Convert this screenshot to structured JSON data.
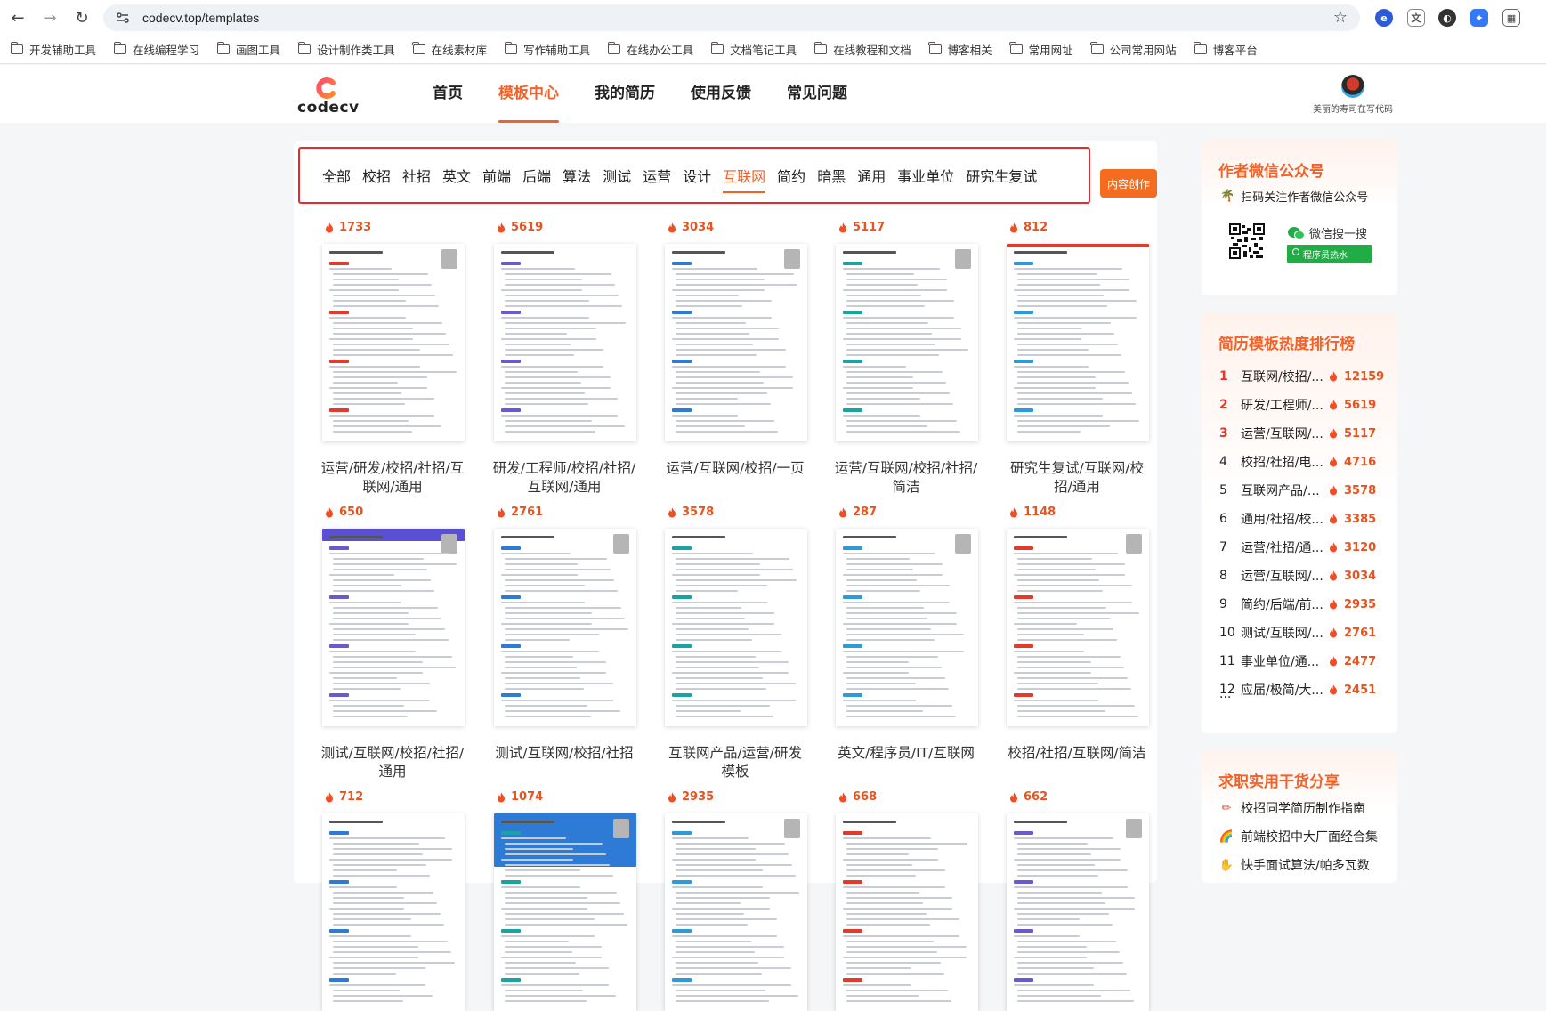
{
  "browser": {
    "url": "codecv.top/templates",
    "bookmarks": [
      "开发辅助工具",
      "在线编程学习",
      "画图工具",
      "设计制作类工具",
      "在线素材库",
      "写作辅助工具",
      "在线办公工具",
      "文档笔记工具",
      "在线教程和文档",
      "博客相关",
      "常用网址",
      "公司常用网站",
      "博客平台"
    ]
  },
  "header": {
    "logo_text": "codecv",
    "nav": [
      "首页",
      "模板中心",
      "我的简历",
      "使用反馈",
      "常见问题"
    ],
    "active_nav": "模板中心",
    "username": "美丽的寿司在写代码"
  },
  "filters": {
    "tags": [
      "全部",
      "校招",
      "社招",
      "英文",
      "前端",
      "后端",
      "算法",
      "测试",
      "运营",
      "设计",
      "互联网",
      "简约",
      "暗黑",
      "通用",
      "事业单位",
      "研究生复试"
    ],
    "active": "互联网",
    "create_button": "内容创作"
  },
  "templates": [
    {
      "hot": "1733",
      "title": "运营/研发/校招/社招/互联网/通用"
    },
    {
      "hot": "5619",
      "title": "研发/工程师/校招/社招/互联网/通用"
    },
    {
      "hot": "3034",
      "title": "运营/互联网/校招/一页"
    },
    {
      "hot": "5117",
      "title": "运营/互联网/校招/社招/简洁"
    },
    {
      "hot": "812",
      "title": "研究生复试/互联网/校招/通用"
    },
    {
      "hot": "650",
      "title": "测试/互联网/校招/社招/通用"
    },
    {
      "hot": "2761",
      "title": "测试/互联网/校招/社招"
    },
    {
      "hot": "3578",
      "title": "互联网产品/运营/研发模板"
    },
    {
      "hot": "287",
      "title": "英文/程序员/IT/互联网"
    },
    {
      "hot": "1148",
      "title": "校招/社招/互联网/简洁"
    },
    {
      "hot": "712",
      "title": ""
    },
    {
      "hot": "1074",
      "title": ""
    },
    {
      "hot": "2935",
      "title": ""
    },
    {
      "hot": "668",
      "title": ""
    },
    {
      "hot": "662",
      "title": ""
    }
  ],
  "sidebar": {
    "wechat": {
      "title": "作者微信公众号",
      "desc": "扫码关注作者微信公众号",
      "search_label": "微信搜一搜",
      "button": "程序员热水"
    },
    "ranking": {
      "title": "简历模板热度排行榜",
      "items": [
        {
          "rank": "1",
          "name": "互联网/校招/...",
          "count": "12159"
        },
        {
          "rank": "2",
          "name": "研发/工程师/...",
          "count": "5619"
        },
        {
          "rank": "3",
          "name": "运营/互联网/...",
          "count": "5117"
        },
        {
          "rank": "4",
          "name": "校招/社招/电...",
          "count": "4716"
        },
        {
          "rank": "5",
          "name": "互联网产品/运...",
          "count": "3578"
        },
        {
          "rank": "6",
          "name": "通用/社招/校...",
          "count": "3385"
        },
        {
          "rank": "7",
          "name": "运营/社招/通...",
          "count": "3120"
        },
        {
          "rank": "8",
          "name": "运营/互联网/...",
          "count": "3034"
        },
        {
          "rank": "9",
          "name": "简约/后端/前...",
          "count": "2935"
        },
        {
          "rank": "10",
          "name": "测试/互联网/...",
          "count": "2761"
        },
        {
          "rank": "11",
          "name": "事业单位/通...",
          "count": "2477"
        },
        {
          "rank": "12",
          "name": "应届/极简/大...",
          "count": "2451"
        }
      ],
      "more": "..."
    },
    "share": {
      "title": "求职实用干货分享",
      "items": [
        "校招同学简历制作指南",
        "前端校招中大厂面经合集",
        "快手面试算法/帕多瓦数"
      ]
    }
  },
  "colors": {
    "accent": "#f0622a",
    "highlight_border": "#e32c2c",
    "rank_top": "#e8332a"
  }
}
